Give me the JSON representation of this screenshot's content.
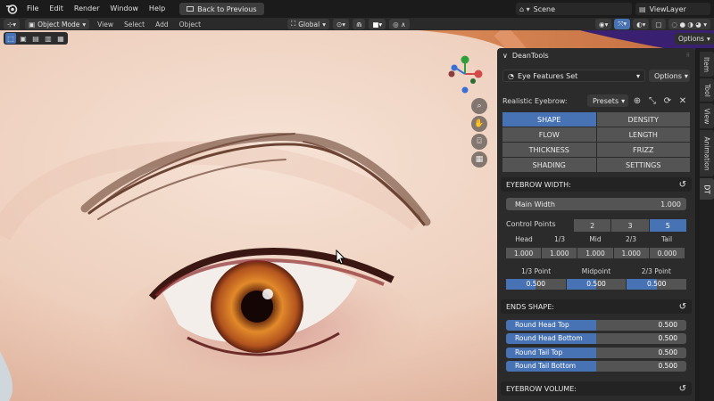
{
  "top_menu": {
    "items": [
      "File",
      "Edit",
      "Render",
      "Window",
      "Help"
    ],
    "back_button": "Back to Previous",
    "scene": "Scene",
    "view_layer": "ViewLayer"
  },
  "header": {
    "mode": "Object Mode",
    "menus": [
      "View",
      "Select",
      "Add",
      "Object"
    ],
    "orientation": "Global",
    "options": "Options"
  },
  "panel": {
    "title": "DeanTools",
    "set_dropdown": "Eye Features Set",
    "options": "Options",
    "eyebrow_label": "Realistic Eyebrow:",
    "presets": "Presets",
    "tabs": [
      "SHAPE",
      "DENSITY",
      "FLOW",
      "LENGTH",
      "THICKNESS",
      "FRIZZ",
      "SHADING",
      "SETTINGS"
    ],
    "active_tab": "SHAPE",
    "width_section": "EYEBROW WIDTH:",
    "main_width": {
      "label": "Main Width",
      "value": "1.000"
    },
    "control_points": {
      "label": "Control Points",
      "options": [
        "2",
        "3",
        "5"
      ],
      "active": "5"
    },
    "cp_headers": [
      "Head",
      "1/3",
      "Mid",
      "2/3",
      "Tail"
    ],
    "cp_values": [
      "1.000",
      "1.000",
      "1.000",
      "1.000",
      "0.000"
    ],
    "point_headers": [
      "1/3 Point",
      "Midpoint",
      "2/3 Point"
    ],
    "point_values": [
      {
        "v": "0.500",
        "f": 0.5
      },
      {
        "v": "0.500",
        "f": 0.5
      },
      {
        "v": "0.500",
        "f": 0.5
      }
    ],
    "ends_section": "ENDS SHAPE:",
    "ends": [
      {
        "label": "Round Head Top",
        "value": "0.500",
        "f": 0.5
      },
      {
        "label": "Round Head Bottom",
        "value": "0.500",
        "f": 0.5
      },
      {
        "label": "Round Tail Top",
        "value": "0.500",
        "f": 0.5
      },
      {
        "label": "Round Tail Bottom",
        "value": "0.500",
        "f": 0.5
      }
    ],
    "volume_section": "EYEBROW VOLUME:"
  },
  "side_tabs": [
    "Item",
    "Tool",
    "View",
    "Animation",
    "DT"
  ],
  "colors": {
    "accent": "#4772b3",
    "panel": "#2b2b2b",
    "button": "#545454"
  }
}
